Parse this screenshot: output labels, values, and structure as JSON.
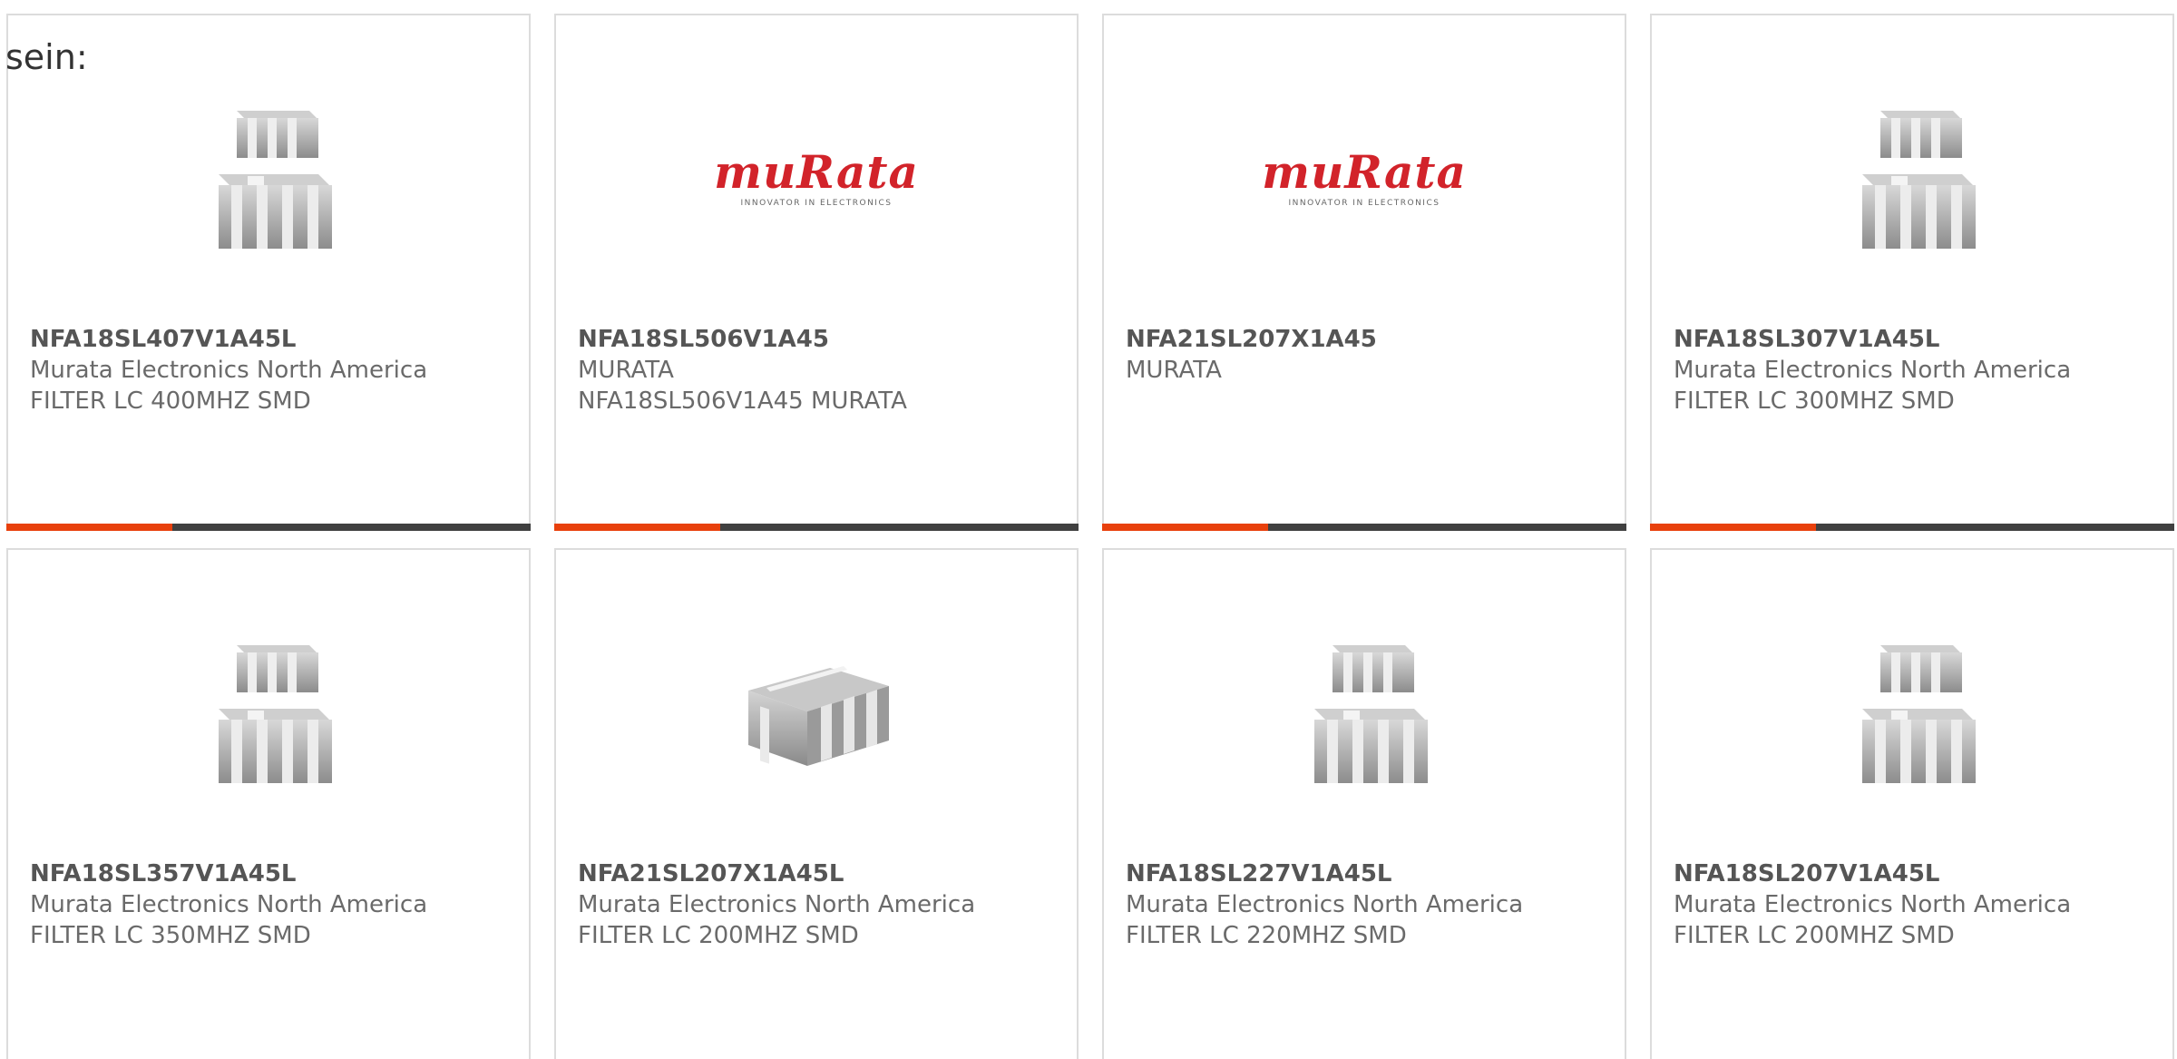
{
  "intro_text": "sein:",
  "brand_logo": {
    "word": "muRata",
    "tagline": "INNOVATOR IN ELECTRONICS",
    "color": "#d2232a"
  },
  "accent_color": "#e8400c",
  "products": [
    {
      "part": "NFA18SL407V1A45L",
      "maker": "Murata Electronics North America",
      "desc": "FILTER LC 400MHZ SMD",
      "image": "stacked-chip-icon"
    },
    {
      "part": "NFA18SL506V1A45",
      "maker": "MURATA",
      "desc": "NFA18SL506V1A45 MURATA",
      "image": "murata-logo"
    },
    {
      "part": "NFA21SL207X1A45",
      "maker": "MURATA",
      "desc": "",
      "image": "murata-logo"
    },
    {
      "part": "NFA18SL307V1A45L",
      "maker": "Murata Electronics North America",
      "desc": "FILTER LC 300MHZ SMD",
      "image": "stacked-chip-icon"
    },
    {
      "part": "NFA18SL357V1A45L",
      "maker": "Murata Electronics North America",
      "desc": "FILTER LC 350MHZ SMD",
      "image": "stacked-chip-icon"
    },
    {
      "part": "NFA21SL207X1A45L",
      "maker": "Murata Electronics North America",
      "desc": "FILTER LC 200MHZ SMD",
      "image": "single-chip-icon"
    },
    {
      "part": "NFA18SL227V1A45L",
      "maker": "Murata Electronics North America",
      "desc": "FILTER LC 220MHZ SMD",
      "image": "stacked-chip-icon"
    },
    {
      "part": "NFA18SL207V1A45L",
      "maker": "Murata Electronics North America",
      "desc": "FILTER LC 200MHZ SMD",
      "image": "stacked-chip-icon"
    }
  ]
}
